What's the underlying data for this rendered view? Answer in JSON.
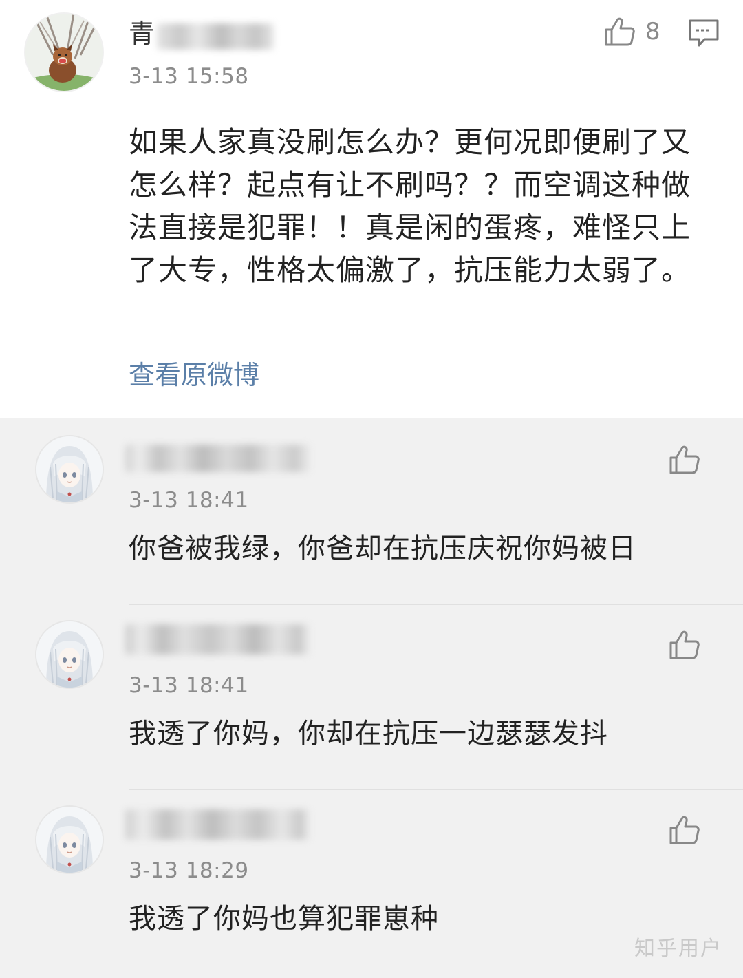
{
  "main_comment": {
    "username_visible": "青",
    "timestamp": "3-13 15:58",
    "like_count": "8",
    "text": "如果人家真没刷怎么办？更何况即便刷了又怎么样？起点有让不刷吗？？而空调这种做法直接是犯罪！！真是闲的蛋疼，难怪只上了大专，性格太偏激了，抗压能力太弱了。",
    "view_original_link": "查看原微博"
  },
  "replies": [
    {
      "timestamp": "3-13 18:41",
      "text": "你爸被我绿，你爸却在抗压庆祝你妈被日"
    },
    {
      "timestamp": "3-13 18:41",
      "text": "我透了你妈，你却在抗压一边瑟瑟发抖"
    },
    {
      "timestamp": "3-13 18:29",
      "text": "我透了你妈也算犯罪崽种"
    }
  ],
  "watermark": "知乎用户",
  "icons": {
    "like": "thumbs-up-icon",
    "comment": "comment-bubble-icon"
  },
  "colors": {
    "link": "#5b7fa8",
    "timestamp": "#8c8c8c",
    "reply_background": "#f1f1f1",
    "main_background": "#ffffff"
  }
}
